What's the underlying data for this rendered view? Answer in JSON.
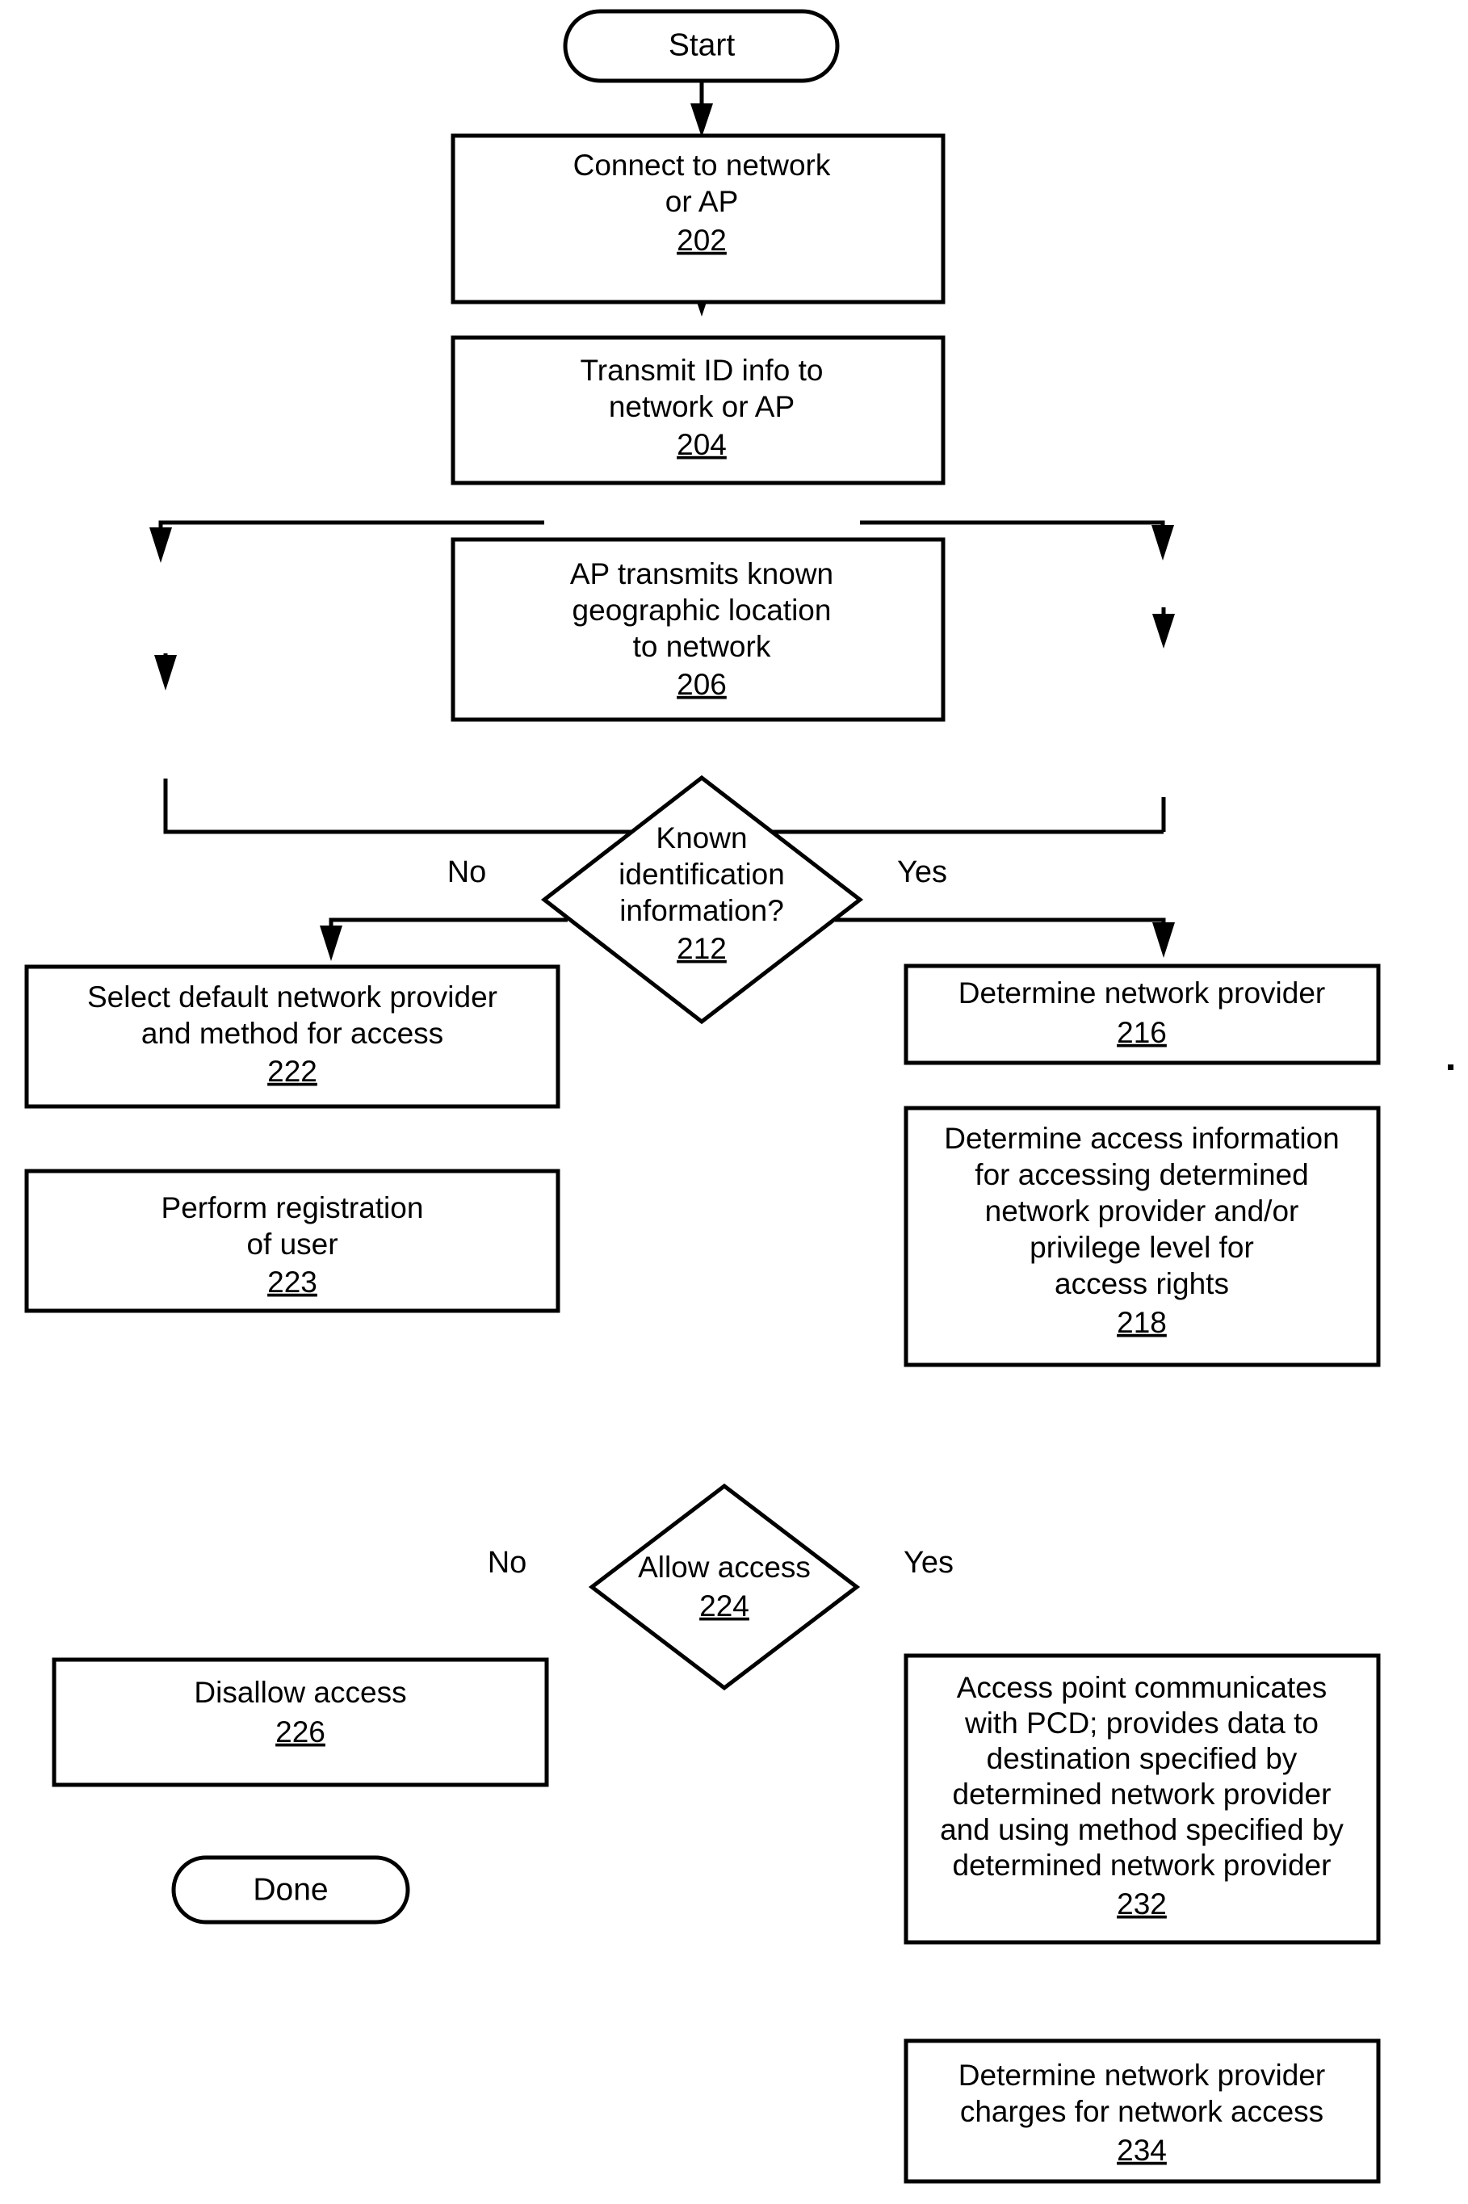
{
  "diagram": {
    "type": "flowchart",
    "title": "Network access flowchart",
    "nodes": {
      "start": {
        "shape": "terminator",
        "label": "Start"
      },
      "n202": {
        "shape": "process",
        "line1": "Connect to network",
        "line2": "or AP",
        "ref": "202"
      },
      "n204": {
        "shape": "process",
        "line1": "Transmit ID info to",
        "line2": "network or AP",
        "ref": "204"
      },
      "n206": {
        "shape": "process",
        "line1": "AP transmits known",
        "line2": "geographic location",
        "line3": "to network",
        "ref": "206"
      },
      "n212": {
        "shape": "decision",
        "line1": "Known",
        "line2": "identification",
        "line3": "information?",
        "ref": "212"
      },
      "n222": {
        "shape": "process",
        "line1": "Select default network provider",
        "line2": "and method for access",
        "ref": "222"
      },
      "n223": {
        "shape": "process",
        "line1": "Perform registration",
        "line2": "of user",
        "ref": "223"
      },
      "n216": {
        "shape": "process",
        "line1": "Determine network provider",
        "ref": "216"
      },
      "n218": {
        "shape": "process",
        "line1": "Determine access information",
        "line2": "for accessing determined",
        "line3": "network provider and/or",
        "line4": "privilege level for",
        "line5": "access rights",
        "ref": "218"
      },
      "n224": {
        "shape": "decision",
        "line1": "Allow access",
        "ref": "224"
      },
      "n226": {
        "shape": "process",
        "line1": "Disallow access",
        "ref": "226"
      },
      "done": {
        "shape": "terminator",
        "label": "Done"
      },
      "n232": {
        "shape": "process",
        "line1": "Access point communicates",
        "line2": "with PCD; provides data to",
        "line3": "destination specified by",
        "line4": "determined network provider",
        "line5": "and using method specified by",
        "line6": "determined network provider",
        "ref": "232"
      },
      "n234": {
        "shape": "process",
        "line1": "Determine network provider",
        "line2": "charges for network access",
        "ref": "234"
      }
    },
    "edge_labels": {
      "no_212": "No",
      "yes_212": "Yes",
      "no_224": "No",
      "yes_224": "Yes"
    },
    "colors": {
      "line": "#000000",
      "fill": "#ffffff",
      "text": "#000000"
    }
  }
}
